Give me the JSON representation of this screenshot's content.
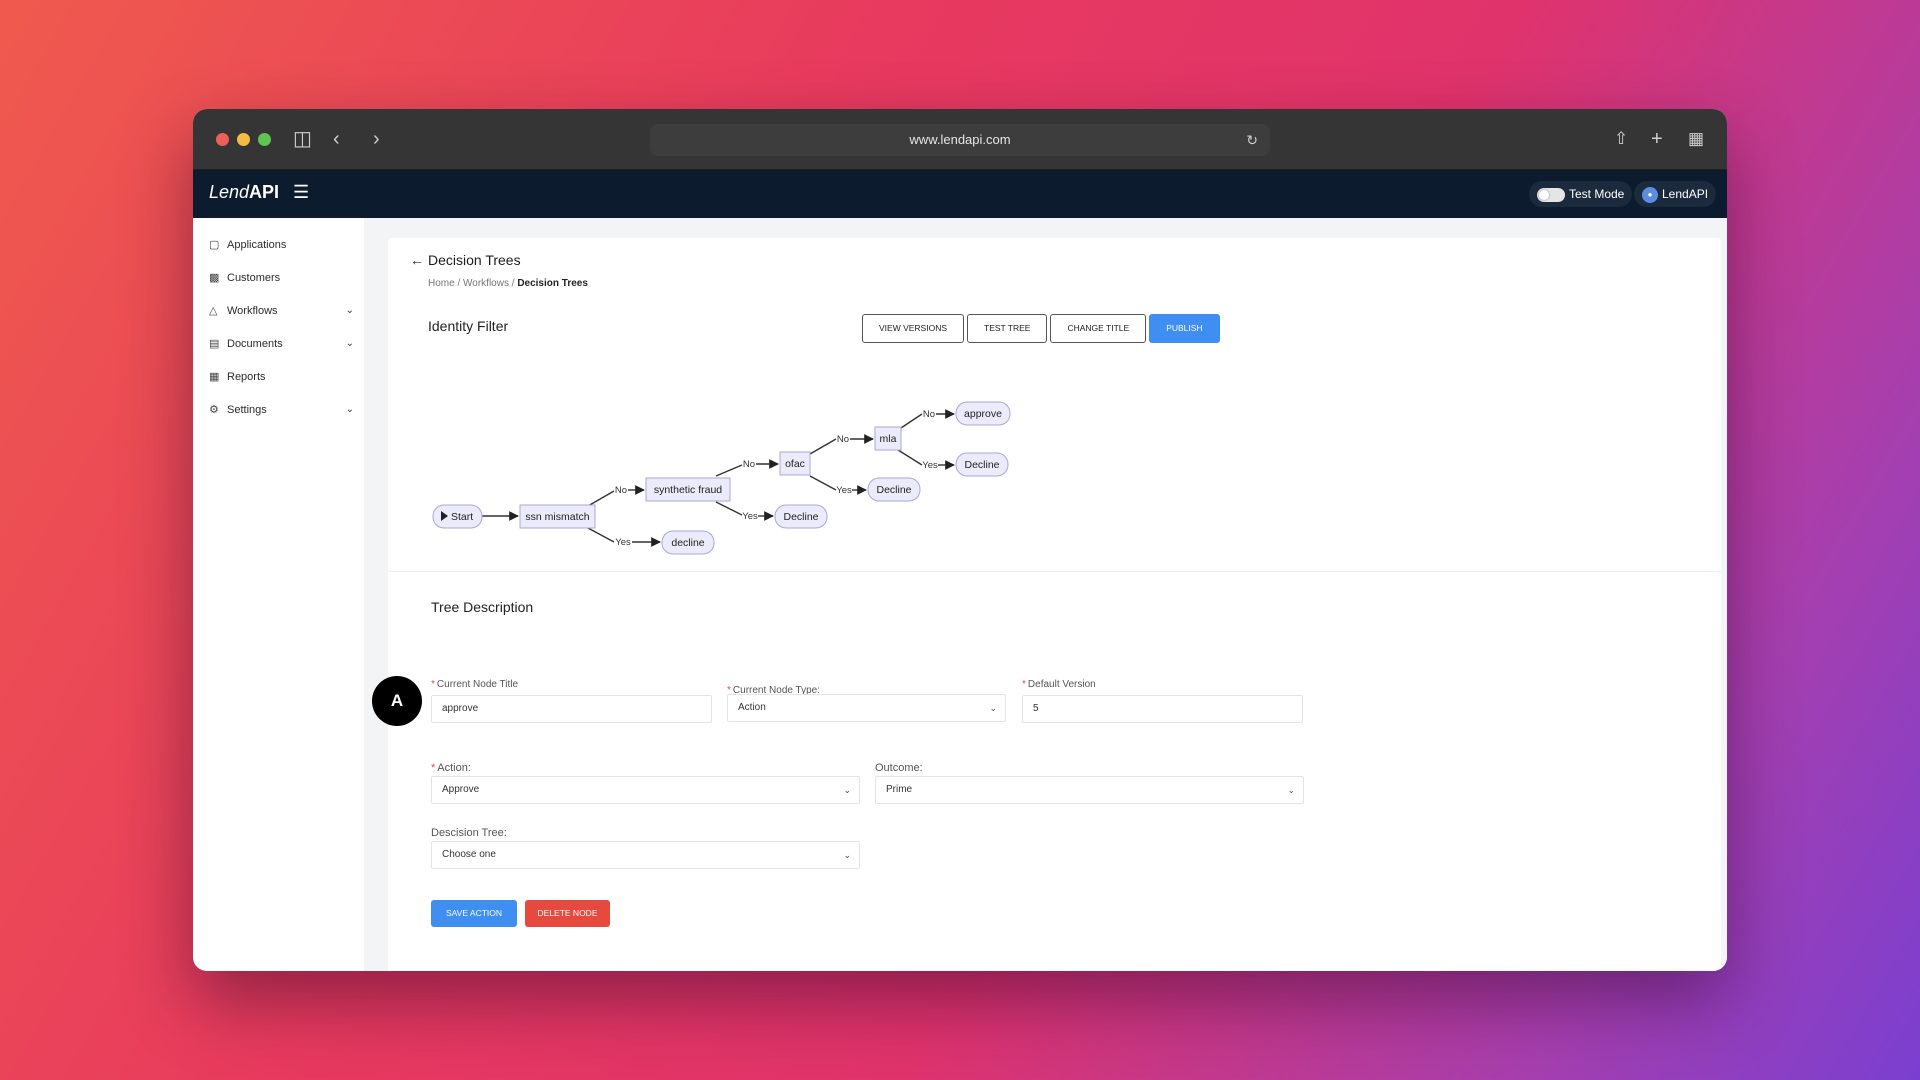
{
  "browser": {
    "url": "www.lendapi.com"
  },
  "app": {
    "logo_light": "Lend",
    "logo_bold": "API",
    "test_mode_label": "Test Mode",
    "user_label": "LendAPI"
  },
  "sidebar": {
    "items": [
      {
        "label": "Applications",
        "icon": "document-icon",
        "has_chevron": false
      },
      {
        "label": "Customers",
        "icon": "people-icon",
        "has_chevron": false
      },
      {
        "label": "Workflows",
        "icon": "workflow-icon",
        "has_chevron": true
      },
      {
        "label": "Documents",
        "icon": "file-icon",
        "has_chevron": true
      },
      {
        "label": "Reports",
        "icon": "chart-icon",
        "has_chevron": false
      },
      {
        "label": "Settings",
        "icon": "gear-icon",
        "has_chevron": true
      }
    ]
  },
  "page": {
    "title": "Decision Trees",
    "breadcrumb": [
      "Home",
      "Workflows",
      "Decision Trees"
    ],
    "tree_name": "Identity Filter",
    "buttons": [
      "VIEW VERSIONS",
      "TEST TREE",
      "CHANGE TITLE",
      "PUBLISH"
    ]
  },
  "tree": {
    "nodes": {
      "start": "Start",
      "ssn": "ssn mismatch",
      "decline1": "decline",
      "synthetic": "synthetic fraud",
      "decline2": "Decline",
      "ofac": "ofac",
      "decline3": "Decline",
      "mla": "mla",
      "decline4": "Decline",
      "approve": "approve"
    },
    "edge_labels": {
      "no": "No",
      "yes": "Yes"
    }
  },
  "form": {
    "section_title": "Tree Description",
    "node_title_label": "Current Node Title",
    "node_title_value": "approve",
    "node_type_label": "Current Node Type:",
    "node_type_value": "Action",
    "default_version_label": "Default Version",
    "default_version_value": "5",
    "action_label": "Action:",
    "action_value": "Approve",
    "outcome_label": "Outcome:",
    "outcome_value": "Prime",
    "decision_tree_label": "Descision Tree:",
    "decision_tree_value": "Choose one",
    "save_label": "SAVE ACTION",
    "delete_label": "DELETE NODE"
  },
  "annotation": {
    "marker": "A"
  }
}
